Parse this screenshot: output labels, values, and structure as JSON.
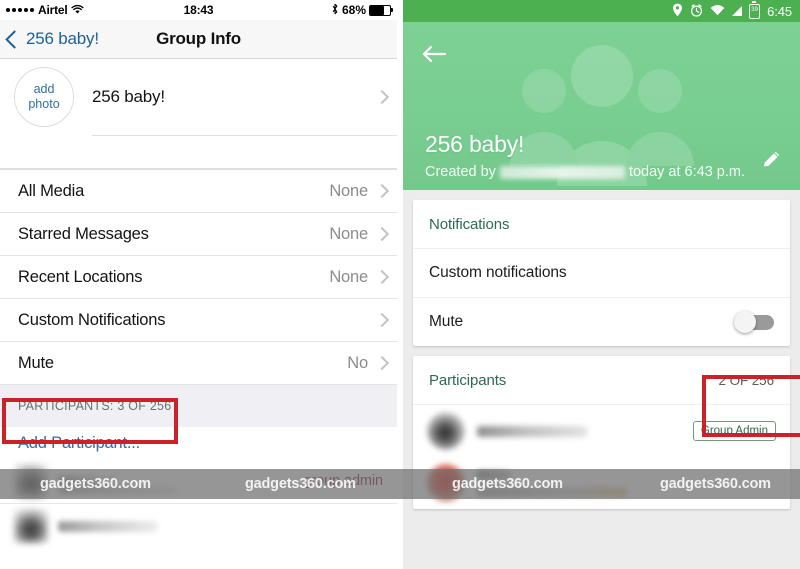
{
  "ios": {
    "status_bar": {
      "carrier": "Airtel",
      "wifi_icon": "wifi-icon",
      "signal_dots": 5,
      "time": "18:43",
      "bluetooth_icon": "bluetooth-icon",
      "battery_percent": "68%",
      "battery_level": 68
    },
    "nav": {
      "back_icon": "chevron-left-icon",
      "back_label": "256 baby!",
      "title": "Group Info"
    },
    "group": {
      "add_photo_line1": "add",
      "add_photo_line2": "photo",
      "name": "256 baby!",
      "chevron_icon": "chevron-right-icon"
    },
    "list": [
      {
        "label": "All Media",
        "value": "None"
      },
      {
        "label": "Starred Messages",
        "value": "None"
      },
      {
        "label": "Recent Locations",
        "value": "None"
      },
      {
        "label": "Custom Notifications",
        "value": ""
      },
      {
        "label": "Mute",
        "value": "No"
      }
    ],
    "participants_header": "PARTICIPANTS: 3 OF 256",
    "add_participant": "Add Participant...",
    "people": [
      {
        "admin_label": "group admin"
      },
      {
        "admin_label": ""
      }
    ]
  },
  "android": {
    "status_bar": {
      "location_icon": "location-pin-icon",
      "alarm_icon": "alarm-clock-icon",
      "wifi_icon": "wifi-icon",
      "signal_icon": "signal-bars-icon",
      "battery_icon": "battery-icon",
      "battery_level": "39",
      "time": "6:45"
    },
    "header": {
      "back_icon": "arrow-left-icon",
      "group_avatar_icon": "group-people-icon",
      "title": "256 baby!",
      "created_prefix": "Created by",
      "created_suffix": "today at 6:43 p.m.",
      "edit_icon": "pencil-edit-icon"
    },
    "notifications_card": [
      {
        "label": "Notifications",
        "type": "section"
      },
      {
        "label": "Custom notifications",
        "type": "row"
      },
      {
        "label": "Mute",
        "type": "toggle",
        "toggle_on": false
      }
    ],
    "participants_card": {
      "label": "Participants",
      "count": "2 OF 256",
      "people": [
        {
          "badge": "Group Admin"
        },
        {
          "badge": ""
        }
      ]
    }
  },
  "watermark": {
    "text": "gadgets360.com"
  },
  "highlight_color": "#cc2127"
}
